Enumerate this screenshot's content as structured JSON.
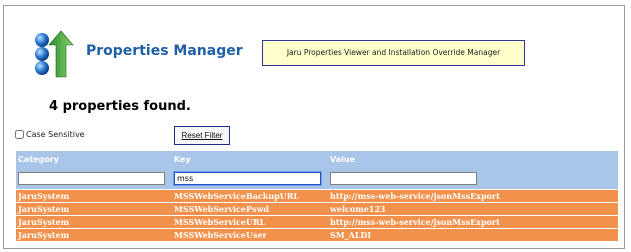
{
  "header": {
    "app_title": "Properties Manager",
    "subtitle": "Jaru Properties Viewer and Installation Override Manager",
    "logo_icon": "arrows-spheres-logo-icon"
  },
  "summary": {
    "count_text": "4 properties found."
  },
  "controls": {
    "case_sensitive_label": "Case Sensitive",
    "case_sensitive_checked": false,
    "reset_label": "Reset Filter"
  },
  "table": {
    "columns": [
      "Category",
      "Key",
      "Value"
    ],
    "filters": {
      "category": "",
      "key": "mss",
      "value": ""
    },
    "rows": [
      [
        "JaruSystem",
        "MSSWebServiceBackupURL",
        "http://mss-web-service/jsonMssExport"
      ],
      [
        "JaruSystem",
        "MSSWebServicePswd",
        "welcome123"
      ],
      [
        "JaruSystem",
        "MSSWebServiceURL",
        "http://mss-web-service/jsonMssExport"
      ],
      [
        "JaruSystem",
        "MSSWebServiceUser",
        "SM_ALDI"
      ]
    ]
  },
  "colors": {
    "title": "#1f5fa8",
    "header_bg": "#a9c6e8",
    "row_bg": "#f2914b",
    "subtitle_bg": "#ffffcc"
  }
}
